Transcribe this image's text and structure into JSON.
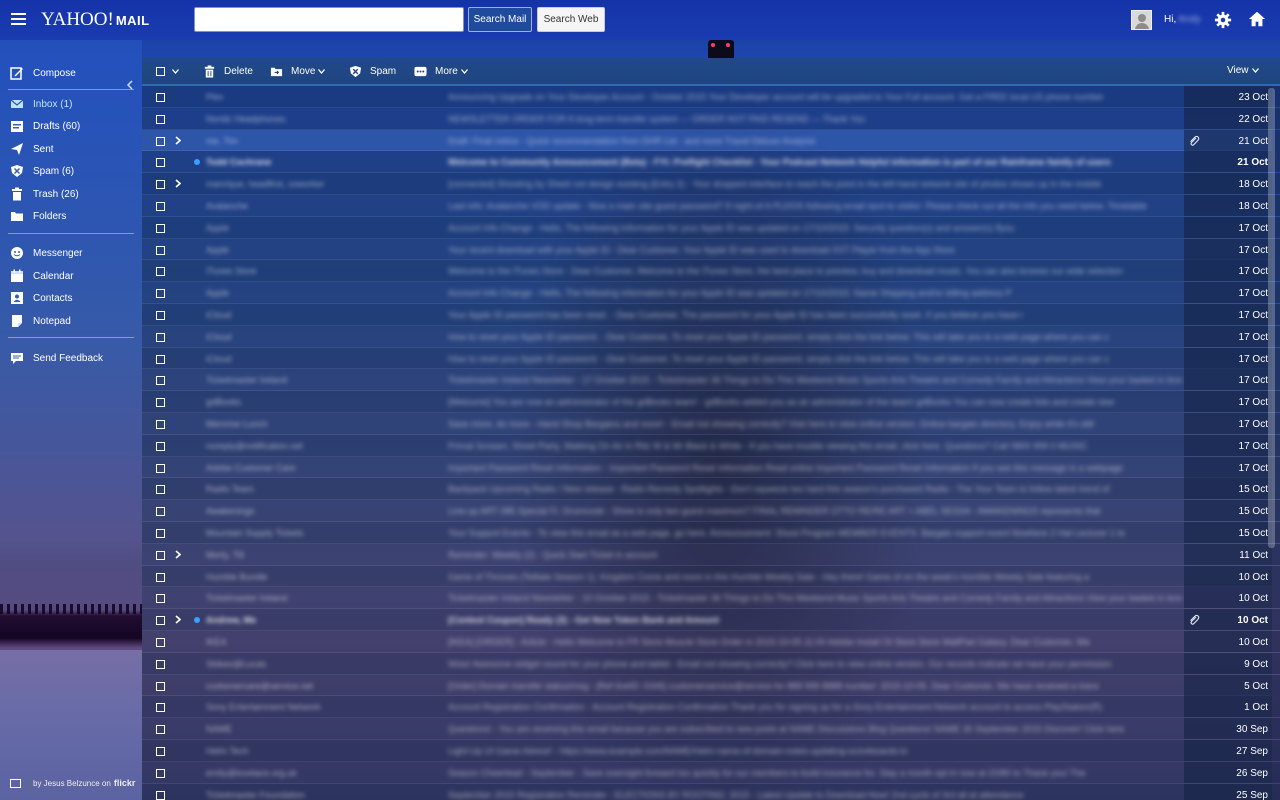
{
  "header": {
    "logo_text": "YAHOO!",
    "logo_sub": "MAIL",
    "search_placeholder": "",
    "search_mail_label": "Search Mail",
    "search_web_label": "Search Web",
    "greeting": "Hi,",
    "user_name": "Andy"
  },
  "sidebar": {
    "compose": "Compose",
    "folders": [
      {
        "label": "Inbox (1)",
        "icon": "inbox-icon"
      },
      {
        "label": "Drafts (60)",
        "icon": "drafts-icon"
      },
      {
        "label": "Sent",
        "icon": "sent-icon"
      },
      {
        "label": "Spam (6)",
        "icon": "spam-icon"
      },
      {
        "label": "Trash (26)",
        "icon": "trash-icon"
      },
      {
        "label": "Folders",
        "icon": "folder-icon"
      }
    ],
    "apps": [
      {
        "label": "Messenger",
        "icon": "messenger-icon"
      },
      {
        "label": "Calendar",
        "icon": "calendar-icon"
      },
      {
        "label": "Contacts",
        "icon": "contacts-icon"
      },
      {
        "label": "Notepad",
        "icon": "notepad-icon"
      }
    ],
    "feedback": "Send Feedback",
    "credit_text": "by Jesus Belzunce on",
    "credit_brand": "flickr"
  },
  "toolbar": {
    "delete": "Delete",
    "move": "Move",
    "spam": "Spam",
    "more": "More",
    "view": "View"
  },
  "colors": {
    "accent": "#1a3cb0",
    "unread_dot": "#3aa0ff",
    "active_folder": "#bfe4ff"
  },
  "messages": [
    {
      "sender": "Plex",
      "subject": "Announcing Upgrade on Your Developer Account - October 2015 Your Developer account will be upgraded to Your Full account. Get a FREE local US phone number",
      "date": "23 Oct",
      "unread": false,
      "thread": false,
      "attach": false
    },
    {
      "sender": "Nordic Headphones",
      "subject": "NEWSLETTER ORDER FOR A long-term transfer system — ORDER NOT PAID RESEND — Thank You",
      "date": "22 Oct",
      "unread": false,
      "thread": false,
      "attach": false
    },
    {
      "sender": "me, Tim",
      "subject": "Draft: Final notice - Quick recommendation from DHR Ltd - and more Travel Deluxe Analysis",
      "date": "21 Oct",
      "unread": false,
      "thread": true,
      "attach": true
    },
    {
      "sender": "Todd Cochrane",
      "subject": "Welcome to Community Announcement (Beta) - FYI: Preflight Checklist - Your Podcast Network Helpful information is part of our Rainframe family of users",
      "date": "21 Oct",
      "unread": true,
      "thread": false,
      "attach": false
    },
    {
      "sender": "manrique, headfirst, coworker",
      "subject": "[connected] Shooting by Sheet not design existing (Entry 2) - Your dropped interface to reach the point in the left-hand network site of photos shows up in the mobile",
      "date": "18 Oct",
      "unread": false,
      "thread": true,
      "attach": false
    },
    {
      "sender": "Avalanche",
      "subject": "Last info: Avalanche VOD update - Now a main site guest password? If night-of A PLDOS following email sent to visitor: Please check out all the info you need below. Timetable",
      "date": "18 Oct",
      "unread": false,
      "thread": false,
      "attach": false
    },
    {
      "sender": "Apple",
      "subject": "Account Info Change - Hello, The following information for your Apple ID was updated on 17/10/2015: Security question(s) and answer(s) Ifyou",
      "date": "17 Oct",
      "unread": false,
      "thread": false,
      "attach": false
    },
    {
      "sender": "Apple",
      "subject": "Your recent download with your Apple ID - Dear Customer, Your Apple ID was used to download XXT Player from the App Store",
      "date": "17 Oct",
      "unread": false,
      "thread": false,
      "attach": false
    },
    {
      "sender": "iTunes Store",
      "subject": "Welcome to the iTunes Store - Dear Customer, Welcome to the iTunes Store, the best place to preview, buy and download music. You can also browse our wide selection",
      "date": "17 Oct",
      "unread": false,
      "thread": false,
      "attach": false
    },
    {
      "sender": "Apple",
      "subject": "Account Info Change - Hello, The following information for your Apple ID was updated on 17/10/2015: Name Shipping and/or billing address P",
      "date": "17 Oct",
      "unread": false,
      "thread": false,
      "attach": false
    },
    {
      "sender": "iCloud",
      "subject": "Your Apple ID password has been reset. - Dear Customer, The password for your Apple ID has been successfully reset. If you believe you have r",
      "date": "17 Oct",
      "unread": false,
      "thread": false,
      "attach": false
    },
    {
      "sender": "iCloud",
      "subject": "How to reset your Apple ID password. - Dear Customer, To reset your Apple ID password, simply click the link below. This will take you to a web page where you can c",
      "date": "17 Oct",
      "unread": false,
      "thread": false,
      "attach": false
    },
    {
      "sender": "iCloud",
      "subject": "How to reset your Apple ID password. - Dear Customer, To reset your Apple ID password, simply click the link below. This will take you to a web page where you can c",
      "date": "17 Oct",
      "unread": false,
      "thread": false,
      "attach": false
    },
    {
      "sender": "Ticketmaster Ireland",
      "subject": "Ticketmaster Ireland Newsletter - 17 October 2015 - Ticketmaster 36 Things to Do This Weekend Music Sports Arts Theatre and Comedy Family and Attractions View your basket in brow",
      "date": "17 Oct",
      "unread": false,
      "thread": false,
      "attach": false
    },
    {
      "sender": "gdBooks",
      "subject": "[Welcome] You are now an administrator of the gdBooks team! - gdBooks added you as an administrator of the team! gdBooks You can now create lists and create new",
      "date": "17 Oct",
      "unread": false,
      "thread": false,
      "attach": false
    },
    {
      "sender": "Memrise Lunch",
      "subject": "Save more, do more - Hand Shop Bargains and more! - Email not showing correctly? Visit here to view online version. Online bargain directory. Enjoy while it's still",
      "date": "17 Oct",
      "unread": false,
      "thread": false,
      "attach": false
    },
    {
      "sender": "noreply@notification.net",
      "subject": "Primal Scream, Street Party, Walking On Air in Ritz W & Mr Black & White - If you have trouble viewing this email, click here. Questions? Call 0800 999 0 MUSIC",
      "date": "17 Oct",
      "unread": false,
      "thread": false,
      "attach": false
    },
    {
      "sender": "Adobe Customer Care",
      "subject": "Important Password Reset Information - Important Password Reset Information Read online Important Password Reset Information If you see this message in a webpage",
      "date": "17 Oct",
      "unread": false,
      "thread": false,
      "attach": false
    },
    {
      "sender": "Radio Team",
      "subject": "Backpack Upcoming Radio / New release - Radio Remedy Spotlights - Don't squeeze too hard this season's purchased Radio - The Your Team to follow latest trend of",
      "date": "15 Oct",
      "unread": false,
      "thread": false,
      "attach": false
    },
    {
      "sender": "Awakenings",
      "subject": "Line-up ART 085 Special Ft. Drumcode - Show is only two guest maximum? FINAL REMINDER OTTO RE/RE ART + ABEL SESSA - AWAKENINGS represents that",
      "date": "15 Oct",
      "unread": false,
      "thread": false,
      "attach": false
    },
    {
      "sender": "Mountain Supply Tickets",
      "subject": "Your Support Events - To view this email as a web page, go here. Announcement: Shoot Program MEMBER EVENTS: Bargain support event Nowhere 2 Hat Lecturer 1 to",
      "date": "15 Oct",
      "unread": false,
      "thread": false,
      "attach": false
    },
    {
      "sender": "Morty, Till",
      "subject": "Reminder: Weekly (2) - Quick Start Ticket in account",
      "date": "11 Oct",
      "unread": false,
      "thread": true,
      "attach": false
    },
    {
      "sender": "Humble Bundle",
      "subject": "Game of Thrones (Telltale Season 1), Kingdom Come and more in this Humble Weekly Sale - Hey there! Game of on the week's Humble Weekly Sale featuring a",
      "date": "10 Oct",
      "unread": false,
      "thread": false,
      "attach": false
    },
    {
      "sender": "Ticketmaster Ireland",
      "subject": "Ticketmaster Ireland Newsletter - 10 October 2015 - Ticketmaster 36 Things to Do This Weekend Music Sports Arts Theatre and Comedy Family and Attractions View your basket in brow",
      "date": "10 Oct",
      "unread": false,
      "thread": false,
      "attach": false
    },
    {
      "sender": "Andrew, Me",
      "subject": "[Contest Coupon] Ready (3) - Get Now Token Bank and Amount",
      "date": "10 Oct",
      "unread": true,
      "thread": true,
      "attach": true
    },
    {
      "sender": "IKEA",
      "subject": "[IKEA] [ORDER] - Article - Hello Welcome to FR Store Muscle Store Order in 2015-10-05 11:00 Adobe Install Ot Store Store WallPart Galaxy. Dear Customer, We",
      "date": "10 Oct",
      "unread": false,
      "thread": false,
      "attach": false
    },
    {
      "sender": "Sbikes@Lucas",
      "subject": "Wow! Awesome widget sound for your phone and tablet - Email not showing correctly? Click here to view online version. Our records indicate we have your permission",
      "date": "9 Oct",
      "unread": false,
      "thread": false,
      "attach": false
    },
    {
      "sender": "customercare@service.net",
      "subject": "[Order] Domain transfer status/msg - [Ref lineID: 0346] customerservice@service for 888 999 8888 number: 2015-10-05. Dear Customer, We have received a trans",
      "date": "5 Oct",
      "unread": false,
      "thread": false,
      "attach": false
    },
    {
      "sender": "Sony Entertainment Network",
      "subject": "Account Registration Confirmation - Account Registration Confirmation Thank you for signing up for a Sony Entertainment Network account to access PlayStation(R)",
      "date": "1 Oct",
      "unread": false,
      "thread": false,
      "attach": false
    },
    {
      "sender": "NAME",
      "subject": "Questions! - You are receiving this email because you are subscribed to new posts at NAME Discussions Blog Questions! NAME 30 September 2015 Discover! Click here",
      "date": "30 Sep",
      "unread": false,
      "thread": false,
      "attach": false
    },
    {
      "sender": "Helm Tech",
      "subject": "Light-Up UI Game Advice! - https://www.example.com/NAME/Helm-name-of-domain-notes-updating-scoreboards-in",
      "date": "27 Sep",
      "unread": false,
      "thread": false,
      "attach": false
    },
    {
      "sender": "emily@lovelace.org.uk",
      "subject": "Season Cheerlead - September - Save overnight forward too quickly for our members to build insurance for. Stay a month opt in now at 20/80 to Thank you! The",
      "date": "26 Sep",
      "unread": false,
      "thread": false,
      "attach": false
    },
    {
      "sender": "Ticketmaster Foundation",
      "subject": "September 2015 Registration Reminder - ELECTIONS BY ROOTING: 2015 - Latest Update to Download Now! 2nd cycle of 3rd all at attendance",
      "date": "25 Sep",
      "unread": false,
      "thread": false,
      "attach": false
    }
  ]
}
